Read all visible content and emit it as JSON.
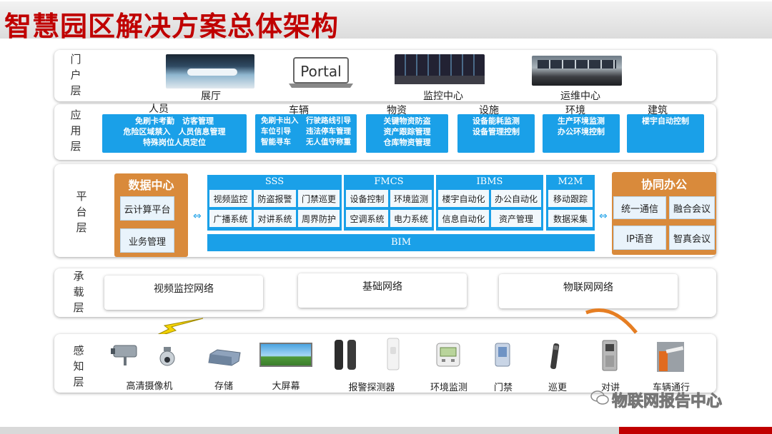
{
  "title": "智慧园区解决方案总体架构",
  "portal": {
    "label": [
      "门",
      "户",
      "层"
    ],
    "items": [
      {
        "caption": "展厅",
        "icon": "exhibition-hall-photo"
      },
      {
        "caption": "",
        "icon": "laptop-icon",
        "screen_text": "Portal"
      },
      {
        "caption": "监控中心",
        "icon": "monitoring-center-photo"
      },
      {
        "caption": "运维中心",
        "icon": "operations-center-photo"
      }
    ]
  },
  "application": {
    "label": [
      "应",
      "用",
      "层"
    ],
    "groups": [
      {
        "title": "人员",
        "lines": [
          "免刷卡考勤　访客管理",
          "危险区域禁入　人员信息管理",
          "特殊岗位人员定位"
        ]
      },
      {
        "title": "车辆",
        "lines": [
          "免刷卡出入　行驶路线引导",
          "车位引导　　违法停车管理",
          "智能寻车　　无人值守称重"
        ]
      },
      {
        "title": "物资",
        "lines": [
          "关键物资防盗",
          "资产跟踪管理",
          "仓库物资管理"
        ]
      },
      {
        "title": "设施",
        "lines": [
          "设备能耗监测",
          "设备管理控制"
        ]
      },
      {
        "title": "环境",
        "lines": [
          "生产环境监测",
          "办公环境控制"
        ]
      },
      {
        "title": "建筑",
        "lines": [
          "楼宇自动控制"
        ]
      }
    ]
  },
  "platform": {
    "label": [
      "平",
      "台",
      "层"
    ],
    "data_center": {
      "title": "数据中心",
      "items": [
        "云计算平台",
        "业务管理"
      ]
    },
    "modules": [
      {
        "title": "SSS",
        "cells": [
          "视频监控",
          "防盗报警",
          "门禁巡更",
          "广播系统",
          "对讲系统",
          "周界防护"
        ]
      },
      {
        "title": "FMCS",
        "cells": [
          "设备控制",
          "环境监测",
          "空调系统",
          "电力系统"
        ]
      },
      {
        "title": "IBMS",
        "cells": [
          "楼宇自动化",
          "办公自动化",
          "信息自动化",
          "资产管理"
        ]
      },
      {
        "title": "M2M",
        "cells": [
          "移动跟踪",
          "数据采集"
        ]
      }
    ],
    "bim": "BIM",
    "collab": {
      "title": "协同办公",
      "items": [
        "统一通信",
        "融合会议",
        "IP语音",
        "智真会议"
      ]
    }
  },
  "transport": {
    "label": [
      "承",
      "载",
      "层"
    ],
    "networks": [
      "视频监控网络",
      "基础网络",
      "物联网网络"
    ]
  },
  "perception": {
    "label": [
      "感",
      "知",
      "层"
    ],
    "devices": [
      {
        "caption": "高清摄像机",
        "icon": "camera-icon"
      },
      {
        "caption": "存储",
        "icon": "storage-icon"
      },
      {
        "caption": "大屏幕",
        "icon": "big-screen-icon"
      },
      {
        "caption": "报警探测器",
        "icon": "alarm-detector-icon"
      },
      {
        "caption": "环境监测",
        "icon": "environment-monitor-icon"
      },
      {
        "caption": "门禁",
        "icon": "access-control-icon"
      },
      {
        "caption": "巡更",
        "icon": "patrol-icon"
      },
      {
        "caption": "对讲",
        "icon": "intercom-icon"
      },
      {
        "caption": "车辆通行",
        "icon": "barrier-gate-icon"
      }
    ]
  },
  "watermark": "物联网报告中心",
  "colors": {
    "title_red": "#c00000",
    "module_blue": "#1aa0e8",
    "side_orange": "#d98a3b",
    "lightning": "#f5d400"
  }
}
